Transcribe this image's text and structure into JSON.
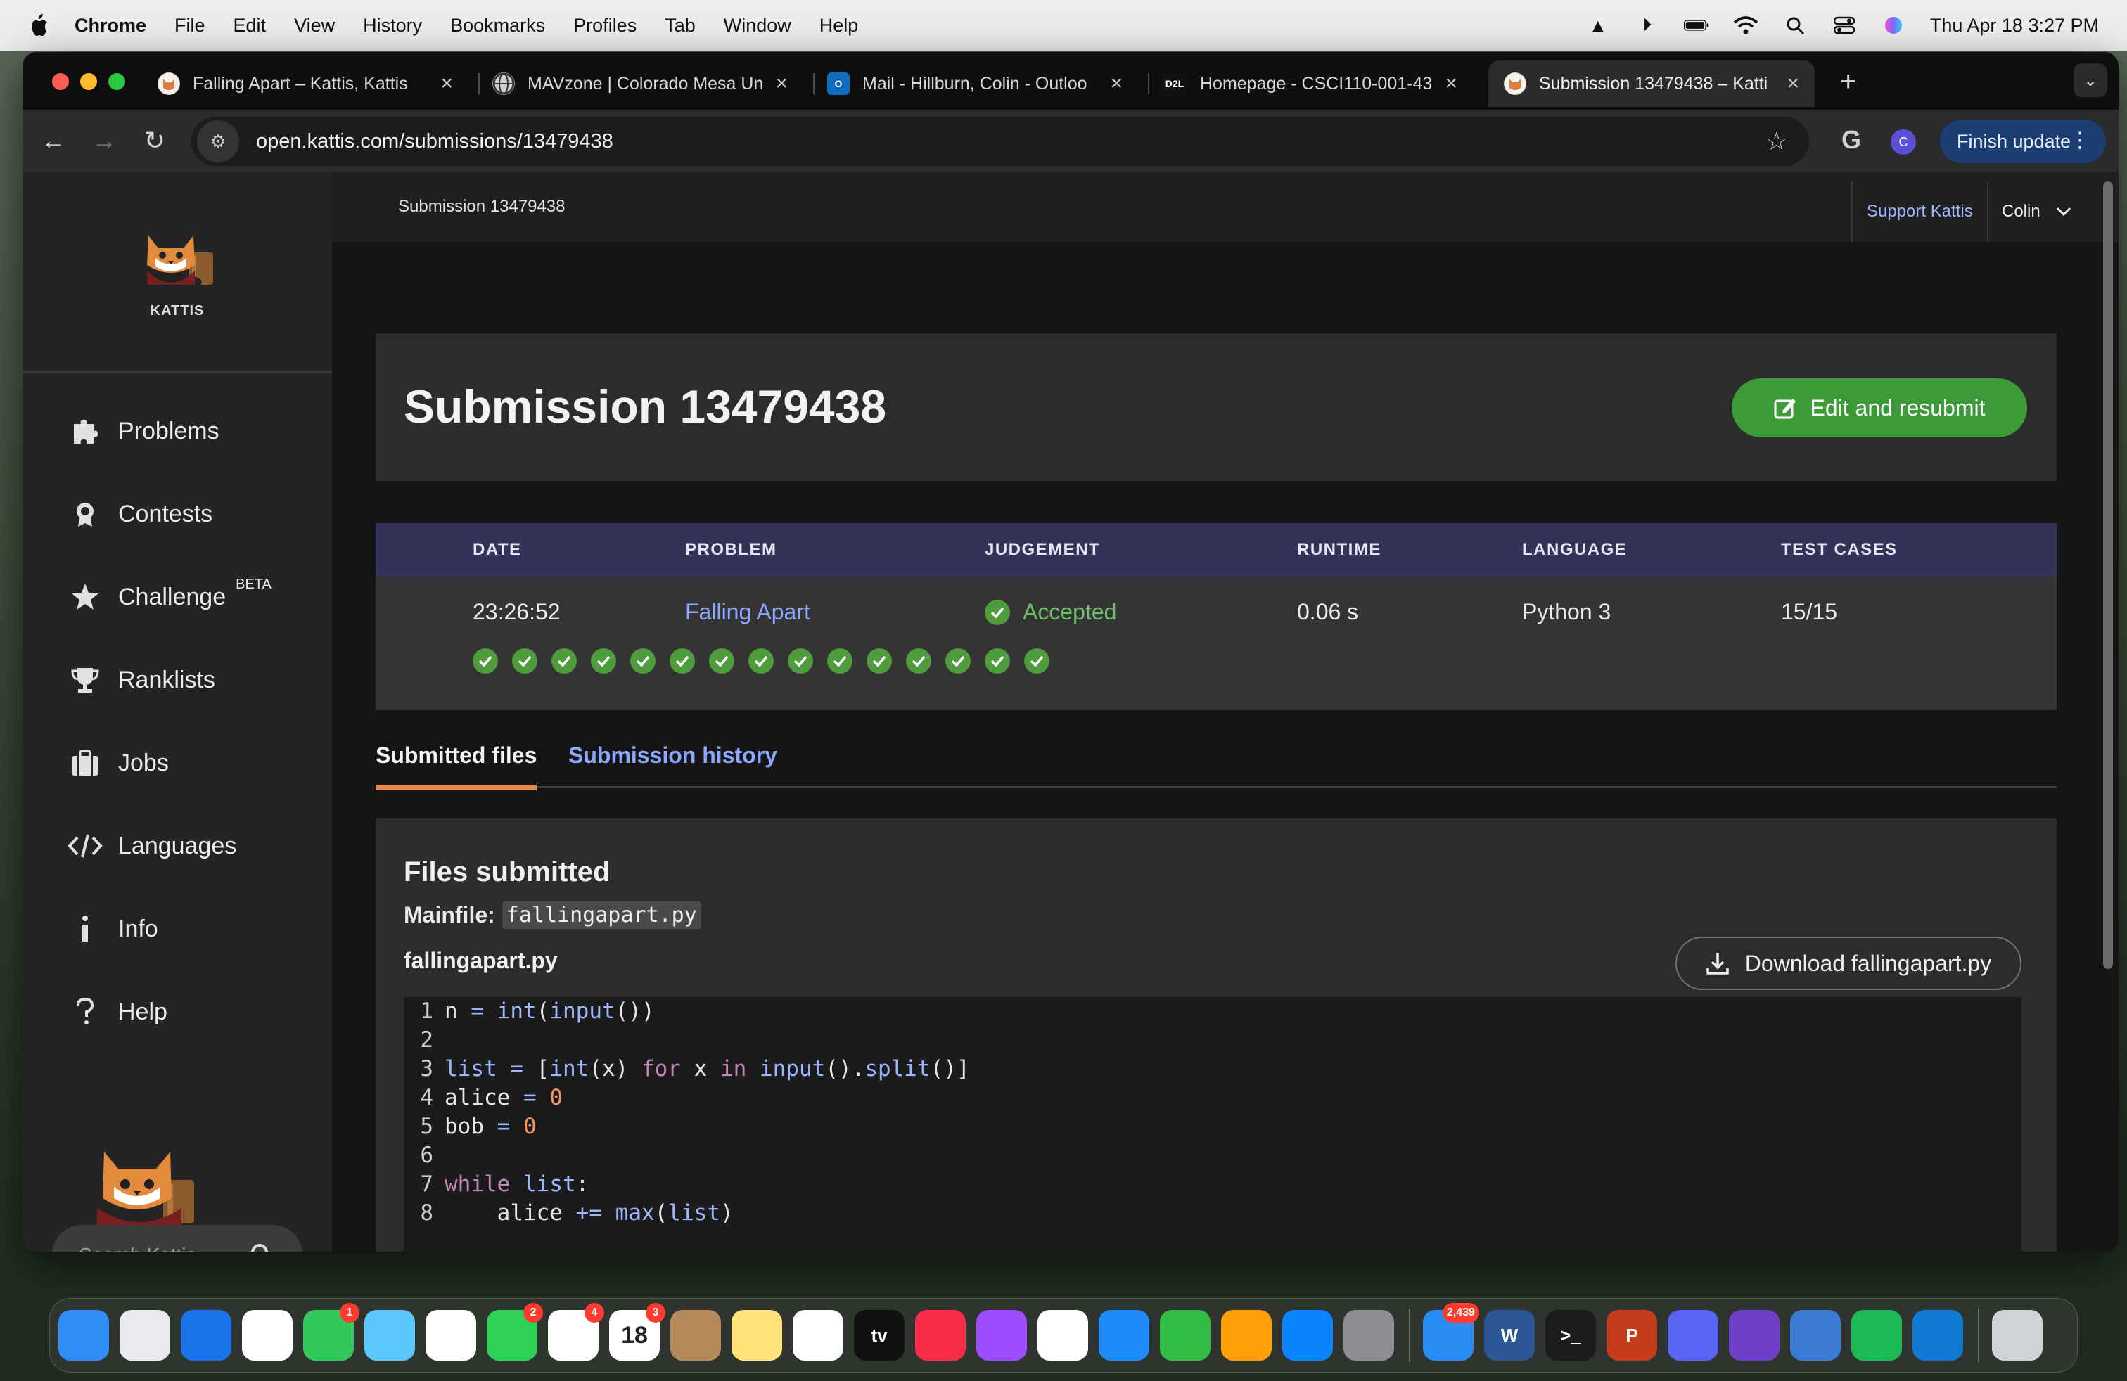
{
  "menubar": {
    "app": "Chrome",
    "items": [
      "File",
      "Edit",
      "View",
      "History",
      "Bookmarks",
      "Profiles",
      "Tab",
      "Window",
      "Help"
    ],
    "clock": "Thu Apr 18  3:27 PM"
  },
  "browser": {
    "tabs": [
      {
        "title": "Falling Apart – Kattis, Kattis",
        "icon": "kattis-icon"
      },
      {
        "title": "MAVzone | Colorado Mesa Un",
        "icon": "globe-icon"
      },
      {
        "title": "Mail - Hillburn, Colin - Outloo",
        "icon": "outlook-icon"
      },
      {
        "title": "Homepage - CSCI110-001-43",
        "icon": "d2l-icon",
        "icon_text": "D2L"
      },
      {
        "title": "Submission 13479438 – Katti",
        "icon": "kattis-icon",
        "active": true
      }
    ],
    "url": "open.kattis.com/submissions/13479438",
    "profile_initial": "C",
    "finish_update": "Finish update"
  },
  "sidebar": {
    "brand": "KATTIS",
    "items": [
      {
        "label": "Problems",
        "icon": "puzzle-icon"
      },
      {
        "label": "Contests",
        "icon": "medal-icon"
      },
      {
        "label": "Challenge",
        "icon": "star-icon",
        "tag": "BETA"
      },
      {
        "label": "Ranklists",
        "icon": "trophy-icon"
      },
      {
        "label": "Jobs",
        "icon": "briefcase-icon"
      },
      {
        "label": "Languages",
        "icon": "code-icon"
      },
      {
        "label": "Info",
        "icon": "info-icon"
      },
      {
        "label": "Help",
        "icon": "help-icon"
      }
    ],
    "search_placeholder": "Search Kattis"
  },
  "topbar": {
    "crumb": "Submission 13479438",
    "support": "Support Kattis",
    "user": "Colin"
  },
  "submission": {
    "title": "Submission 13479438",
    "resubmit": "Edit and resubmit",
    "headers": [
      "DATE",
      "PROBLEM",
      "JUDGEMENT",
      "RUNTIME",
      "LANGUAGE",
      "TEST CASES"
    ],
    "date": "23:26:52",
    "problem": "Falling Apart",
    "judgement": "Accepted",
    "runtime": "0.06 s",
    "language": "Python 3",
    "test_cases": "15/15",
    "passed_tests": 15
  },
  "tabs": {
    "submitted": "Submitted files",
    "history": "Submission history"
  },
  "files": {
    "heading": "Files submitted",
    "mainfile_label": "Mainfile:",
    "mainfile": "fallingapart.py",
    "filename": "fallingapart.py",
    "download": "Download fallingapart.py",
    "code_lines": [
      "n = int(input())",
      "",
      "list = [int(x) for x in input().split()]",
      "alice = 0",
      "bob = 0",
      "",
      "while list:",
      "    alice += max(list)"
    ]
  },
  "dock": {
    "apps": [
      {
        "name": "finder-icon",
        "color": "#2f8df5"
      },
      {
        "name": "launchpad-icon",
        "color": "#e9e9ee"
      },
      {
        "name": "safari-icon",
        "color": "#1a73e8"
      },
      {
        "name": "chrome-icon",
        "color": "#ffffff"
      },
      {
        "name": "messages-icon",
        "color": "#34c759",
        "badge": "1"
      },
      {
        "name": "maps-icon",
        "color": "#5ac8fa"
      },
      {
        "name": "photos-icon",
        "color": "#ffffff"
      },
      {
        "name": "facetime-icon",
        "color": "#30d158",
        "badge": "2"
      },
      {
        "name": "reminders-icon",
        "color": "#ffffff",
        "badge": "4"
      },
      {
        "name": "calendar-icon",
        "color": "#ffffff",
        "badge": "3",
        "label": "18",
        "sub": "APR"
      },
      {
        "name": "contacts-icon",
        "color": "#b48a5a"
      },
      {
        "name": "notes-icon",
        "color": "#ffe37a"
      },
      {
        "name": "freeform-icon",
        "color": "#ffffff"
      },
      {
        "name": "tv-icon",
        "color": "#111111",
        "label": "tv"
      },
      {
        "name": "music-icon",
        "color": "#fa2d48"
      },
      {
        "name": "podcasts-icon",
        "color": "#9b4dff"
      },
      {
        "name": "news-icon",
        "color": "#ffffff"
      },
      {
        "name": "keynote-icon",
        "color": "#1d8cf8"
      },
      {
        "name": "numbers-icon",
        "color": "#2fbd43"
      },
      {
        "name": "pages-icon",
        "color": "#ff9f0a"
      },
      {
        "name": "appstore-icon",
        "color": "#0a84ff"
      },
      {
        "name": "settings-icon",
        "color": "#8e8e93"
      },
      {
        "name": "mail-icon",
        "color": "#2a8cf5",
        "badge": "2,439"
      },
      {
        "name": "word-icon",
        "color": "#2b5797",
        "label": "W"
      },
      {
        "name": "terminal-icon",
        "color": "#1c1c1e",
        "label": ">_"
      },
      {
        "name": "powerpoint-icon",
        "color": "#c43e1c",
        "label": "P"
      },
      {
        "name": "discord-icon",
        "color": "#5865f2"
      },
      {
        "name": "github-icon",
        "color": "#6e40c9"
      },
      {
        "name": "browser-globe-icon",
        "color": "#3a7bd5"
      },
      {
        "name": "spotify-icon",
        "color": "#1db954"
      },
      {
        "name": "vscode-icon",
        "color": "#0e7ad1"
      },
      {
        "name": "trash-icon",
        "color": "#cfd3d8"
      }
    ]
  }
}
